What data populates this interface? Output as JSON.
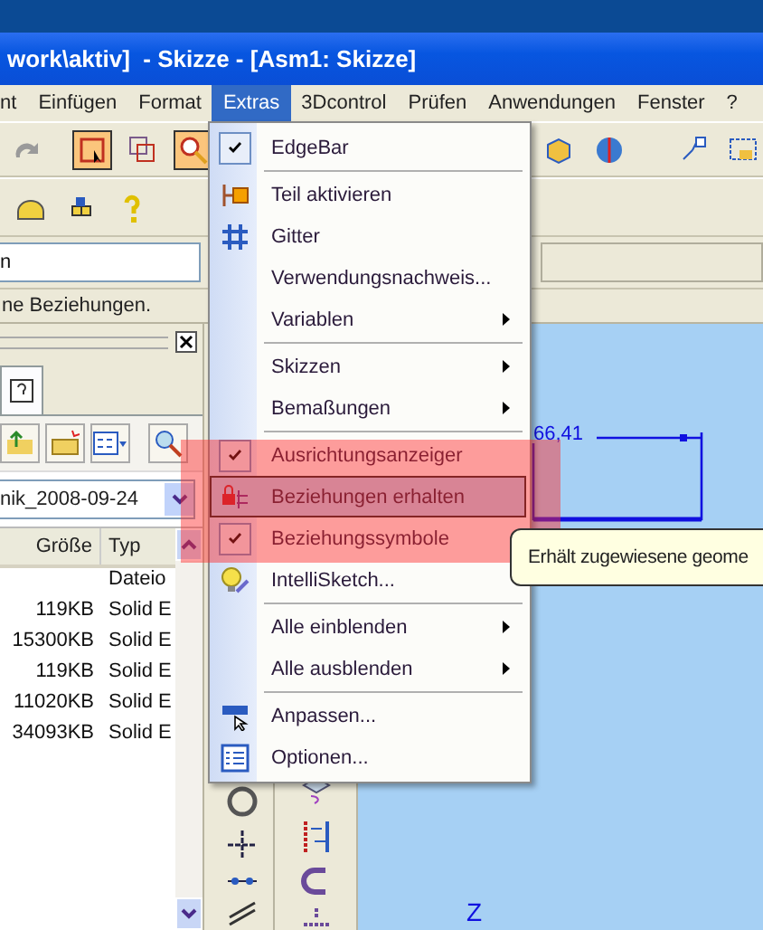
{
  "window": {
    "title": "work\\aktiv]  - Skizze - [Asm1: Skizze]"
  },
  "menu_bar": [
    {
      "label": "nt",
      "selected": false
    },
    {
      "label": "Einfügen",
      "selected": false
    },
    {
      "label": "Format",
      "selected": false
    },
    {
      "label": "Extras",
      "selected": true
    },
    {
      "label": "3Dcontrol",
      "selected": false
    },
    {
      "label": "Prüfen",
      "selected": false
    },
    {
      "label": "Anwendungen",
      "selected": false
    },
    {
      "label": "Fenster",
      "selected": false
    },
    {
      "label": "?",
      "selected": false
    }
  ],
  "command_field": {
    "value": "n"
  },
  "prompt": "ne Beziehungen.",
  "library_pane": {
    "folder": "nik_2008-09-24",
    "columns": [
      "Größe",
      "Typ"
    ],
    "rows": [
      {
        "type": "Dateio"
      },
      {
        "size": "119KB",
        "type": "Solid E"
      },
      {
        "size": "15300KB",
        "type": "Solid E"
      },
      {
        "size": "119KB",
        "type": "Solid E"
      },
      {
        "size": "11020KB",
        "type": "Solid E"
      },
      {
        "size": "34093KB",
        "type": "Solid E"
      }
    ]
  },
  "extras_menu": {
    "items": [
      {
        "kind": "item",
        "label": "EdgeBar",
        "checked": true,
        "selected": false,
        "submenu": false
      },
      {
        "kind": "separator"
      },
      {
        "kind": "item",
        "label": "Teil aktivieren",
        "checked": false,
        "selected": false,
        "submenu": false
      },
      {
        "kind": "item",
        "label": "Gitter",
        "checked": false,
        "selected": false,
        "submenu": false
      },
      {
        "kind": "item",
        "label": "Verwendungsnachweis...",
        "checked": false,
        "selected": false,
        "submenu": false
      },
      {
        "kind": "item",
        "label": "Variablen",
        "checked": false,
        "selected": false,
        "submenu": true
      },
      {
        "kind": "separator"
      },
      {
        "kind": "item",
        "label": "Skizzen",
        "checked": false,
        "selected": false,
        "submenu": true
      },
      {
        "kind": "item",
        "label": "Bemaßungen",
        "checked": false,
        "selected": false,
        "submenu": true
      },
      {
        "kind": "separator"
      },
      {
        "kind": "item",
        "label": "Ausrichtungsanzeiger",
        "checked": true,
        "selected": false,
        "submenu": false
      },
      {
        "kind": "item",
        "label": "Beziehungen erhalten",
        "checked": false,
        "selected": true,
        "submenu": false
      },
      {
        "kind": "item",
        "label": "Beziehungssymbole",
        "checked": true,
        "selected": false,
        "submenu": false
      },
      {
        "kind": "item",
        "label": "IntelliSketch...",
        "checked": false,
        "selected": false,
        "submenu": false
      },
      {
        "kind": "separator"
      },
      {
        "kind": "item",
        "label": "Alle einblenden",
        "checked": false,
        "selected": false,
        "submenu": true
      },
      {
        "kind": "item",
        "label": "Alle ausblenden",
        "checked": false,
        "selected": false,
        "submenu": true
      },
      {
        "kind": "separator"
      },
      {
        "kind": "item",
        "label": "Anpassen...",
        "checked": false,
        "selected": false,
        "submenu": false
      },
      {
        "kind": "item",
        "label": "Optionen...",
        "checked": false,
        "selected": false,
        "submenu": false
      }
    ]
  },
  "tooltip": "Erhält zugewiesene geome",
  "sketch": {
    "dimension": "66,41",
    "axis_label": "Z"
  }
}
